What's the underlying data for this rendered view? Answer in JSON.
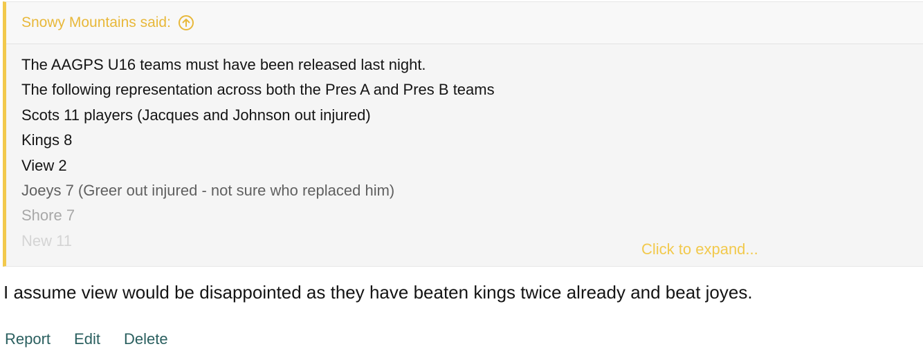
{
  "quote": {
    "author_label": "Snowy Mountains said:",
    "jump_icon": "arrow-up-circle-icon",
    "lines": [
      "The AAGPS U16 teams must have been released last night.",
      "The following representation across both the Pres A and Pres B teams",
      "Scots 11 players (Jacques and Johnson out injured)",
      "Kings 8",
      "View 2",
      "Joeys 7 (Greer out injured - not sure who replaced him)",
      "Shore 7",
      "New 11"
    ],
    "expand_label": "Click to expand...",
    "accent_color": "#f2c94c"
  },
  "post": {
    "text": "I assume view would be disappointed as they have beaten kings twice already and beat joyes."
  },
  "actions": {
    "report_label": "Report",
    "edit_label": "Edit",
    "delete_label": "Delete",
    "link_color": "#2a5f5f"
  }
}
